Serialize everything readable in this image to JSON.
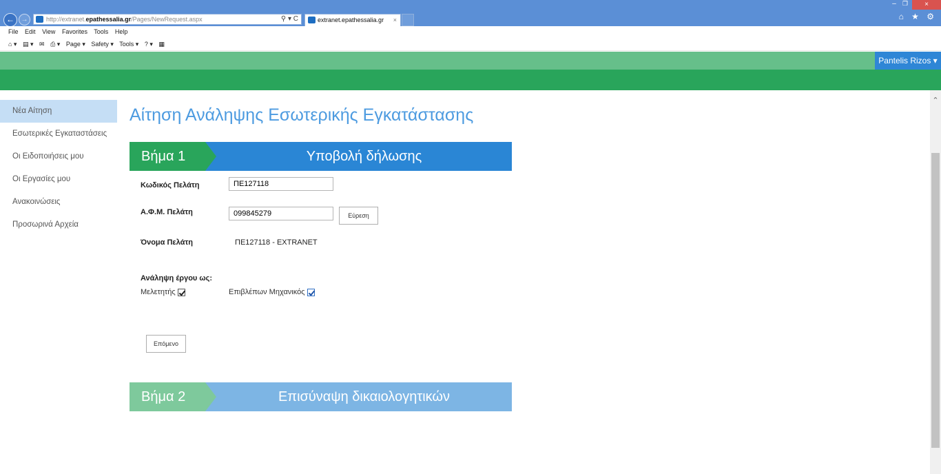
{
  "browser": {
    "url_prefix": "http://extranet.",
    "url_domain": "epathessalia.gr",
    "url_path": "/Pages/NewRequest.aspx",
    "address_tools": "⚲ ▾ C",
    "tab_title": "extranet.epathessalia.gr",
    "tab_close": "×",
    "back": "←",
    "forward": "→",
    "min": "–",
    "max": "❐",
    "close": "×",
    "right_icons": "⌂ ★ ⚙"
  },
  "menubar": [
    "File",
    "Edit",
    "View",
    "Favorites",
    "Tools",
    "Help"
  ],
  "cmdbar": [
    "⌂ ▾",
    "▤ ▾",
    "✉",
    "⎙ ▾",
    "Page ▾",
    "Safety ▾",
    "Tools ▾",
    "? ▾",
    "▦"
  ],
  "header": {
    "user": "Pantelis Rizos ▾"
  },
  "sidebar": [
    {
      "label": "Νέα Αίτηση",
      "active": true
    },
    {
      "label": "Εσωτερικές Εγκαταστάσεις"
    },
    {
      "label": "Οι Ειδοποιήσεις μου"
    },
    {
      "label": "Οι Εργασίες μου"
    },
    {
      "label": "Ανακοινώσεις"
    },
    {
      "label": "Προσωρινά Αρχεία"
    }
  ],
  "page": {
    "title": "Αίτηση Ανάληψης Εσωτερικής Εγκατάστασης"
  },
  "step1": {
    "number": "Βήμα 1",
    "title": "Υποβολή δήλωσης"
  },
  "step2": {
    "number": "Βήμα 2",
    "title": "Επισύναψη δικαιολογητικών"
  },
  "form": {
    "client_code_label": "Κωδικός Πελάτη",
    "client_code_value": "ΠΕ127118",
    "afm_label": "Α.Φ.Μ. Πελάτη",
    "afm_value": "099845279",
    "search_button": "Εύρεση",
    "client_name_label": "Όνομα Πελάτη",
    "client_name_value": "ΠΕ127118 - EXTRANET",
    "role_label": "Ανάληψη έργου ως:",
    "role_designer": "Μελετητής",
    "role_supervisor": "Επιβλέπων Μηχανικός",
    "next_button": "Επόμενο"
  },
  "scrollbar": {
    "up": "⌃"
  }
}
